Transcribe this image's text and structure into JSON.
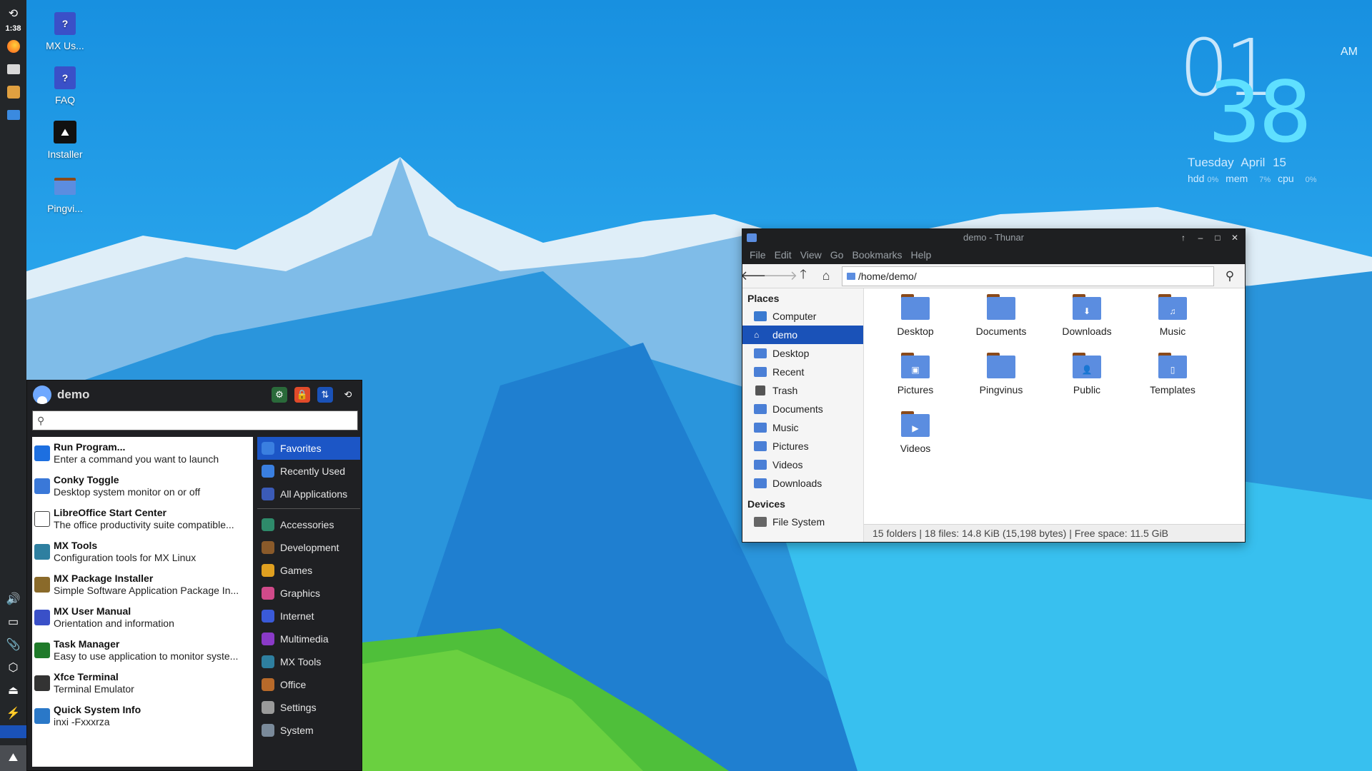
{
  "panel": {
    "clock": "1:38",
    "colors": {
      "bg": "#232629"
    }
  },
  "desktop": {
    "icons": [
      {
        "label": "MX Us...",
        "icon": "help-icon"
      },
      {
        "label": "FAQ",
        "icon": "help-icon"
      },
      {
        "label": "Installer",
        "icon": "installer-icon"
      },
      {
        "label": "Pingvi...",
        "icon": "folder-icon"
      }
    ]
  },
  "conky": {
    "hour": "01",
    "minute": "38",
    "ampm": "AM",
    "day": "Tuesday",
    "date": "April 15",
    "hdd_label": "hdd",
    "hdd_val": "0%",
    "mem_label": "mem",
    "mem_val": "7%",
    "cpu_label": "cpu",
    "cpu_val": "0%"
  },
  "thunar": {
    "title": "demo - Thunar",
    "menu": [
      "File",
      "Edit",
      "View",
      "Go",
      "Bookmarks",
      "Help"
    ],
    "path": "/home/demo/",
    "places_header": "Places",
    "places": [
      "Computer",
      "demo",
      "Desktop",
      "Recent",
      "Trash",
      "Documents",
      "Music",
      "Pictures",
      "Videos",
      "Downloads"
    ],
    "selected_place": "demo",
    "devices_header": "Devices",
    "devices": [
      "File System"
    ],
    "files": [
      {
        "name": "Desktop",
        "glyph": ""
      },
      {
        "name": "Documents",
        "glyph": ""
      },
      {
        "name": "Downloads",
        "glyph": "⬇"
      },
      {
        "name": "Music",
        "glyph": "♫"
      },
      {
        "name": "Pictures",
        "glyph": "▣"
      },
      {
        "name": "Pingvinus",
        "glyph": ""
      },
      {
        "name": "Public",
        "glyph": "👤"
      },
      {
        "name": "Templates",
        "glyph": "▯"
      },
      {
        "name": "Videos",
        "glyph": "▶"
      }
    ],
    "status": "15 folders  |  18 files: 14.8 KiB (15,198 bytes)  |  Free space: 11.5 GiB"
  },
  "menu": {
    "username": "demo",
    "search_placeholder": "",
    "items": [
      {
        "title": "Run Program...",
        "desc": "Enter a command you want to launch",
        "color": "#1d6fe0"
      },
      {
        "title": "Conky Toggle",
        "desc": "Desktop system monitor on or off",
        "color": "#3a78d8"
      },
      {
        "title": "LibreOffice Start Center",
        "desc": "The office productivity suite compatible...",
        "color": "#ffffff"
      },
      {
        "title": "MX Tools",
        "desc": "Configuration tools for MX Linux",
        "color": "#2e7fa0"
      },
      {
        "title": "MX Package Installer",
        "desc": "Simple Software Application Package In...",
        "color": "#8a6a2a"
      },
      {
        "title": "MX User Manual",
        "desc": "Orientation and information",
        "color": "#3a50c8"
      },
      {
        "title": "Task Manager",
        "desc": "Easy to use application to monitor syste...",
        "color": "#1f7a2a"
      },
      {
        "title": "Xfce Terminal",
        "desc": "Terminal Emulator",
        "color": "#333333"
      },
      {
        "title": "Quick System Info",
        "desc": "inxi -Fxxxrza",
        "color": "#2a78c8"
      }
    ],
    "categories_top": [
      {
        "label": "Favorites",
        "color": "#3a7fe0"
      },
      {
        "label": "Recently Used",
        "color": "#3a7fe0"
      },
      {
        "label": "All Applications",
        "color": "#3b5bb8"
      }
    ],
    "selected_category": "Favorites",
    "categories": [
      {
        "label": "Accessories",
        "color": "#2e8a6a"
      },
      {
        "label": "Development",
        "color": "#8a5a2a"
      },
      {
        "label": "Games",
        "color": "#e0a020"
      },
      {
        "label": "Graphics",
        "color": "#d04a8a"
      },
      {
        "label": "Internet",
        "color": "#3a5ad8"
      },
      {
        "label": "Multimedia",
        "color": "#8a3ac8"
      },
      {
        "label": "MX Tools",
        "color": "#2e7fa0"
      },
      {
        "label": "Office",
        "color": "#b86a2a"
      },
      {
        "label": "Settings",
        "color": "#9a9a9a"
      },
      {
        "label": "System",
        "color": "#7a8a9a"
      }
    ]
  }
}
